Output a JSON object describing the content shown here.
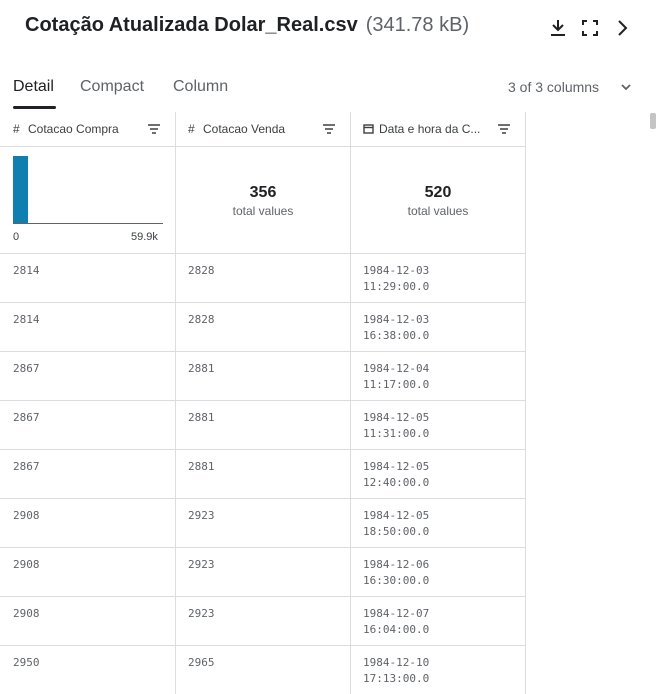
{
  "header": {
    "filename": "Cotação Atualizada Dolar_Real.csv",
    "filesize": "(341.78 kB)"
  },
  "tabs": [
    {
      "label": "Detail",
      "active": true
    },
    {
      "label": "Compact",
      "active": false
    },
    {
      "label": "Column",
      "active": false
    }
  ],
  "column_count": "3 of 3 columns",
  "columns": [
    {
      "type_icon": "hash-icon",
      "name": "Cotacao Compra"
    },
    {
      "type_icon": "hash-icon",
      "name": "Cotacao Venda"
    },
    {
      "type_icon": "calendar-icon",
      "name": "Data e hora da C..."
    }
  ],
  "summary": {
    "col1_hist": {
      "min": "0",
      "max": "59.9k"
    },
    "col2": {
      "value": "356",
      "label": "total values"
    },
    "col3": {
      "value": "520",
      "label": "total values"
    }
  },
  "rows": [
    {
      "compra": "2814",
      "venda": "2828",
      "data": "1984-12-03\n11:29:00.0"
    },
    {
      "compra": "2814",
      "venda": "2828",
      "data": "1984-12-03\n16:38:00.0"
    },
    {
      "compra": "2867",
      "venda": "2881",
      "data": "1984-12-04\n11:17:00.0"
    },
    {
      "compra": "2867",
      "venda": "2881",
      "data": "1984-12-05\n11:31:00.0"
    },
    {
      "compra": "2867",
      "venda": "2881",
      "data": "1984-12-05\n12:40:00.0"
    },
    {
      "compra": "2908",
      "venda": "2923",
      "data": "1984-12-05\n18:50:00.0"
    },
    {
      "compra": "2908",
      "venda": "2923",
      "data": "1984-12-06\n16:30:00.0"
    },
    {
      "compra": "2908",
      "venda": "2923",
      "data": "1984-12-07\n16:04:00.0"
    },
    {
      "compra": "2950",
      "venda": "2965",
      "data": "1984-12-10\n17:13:00.0"
    }
  ]
}
